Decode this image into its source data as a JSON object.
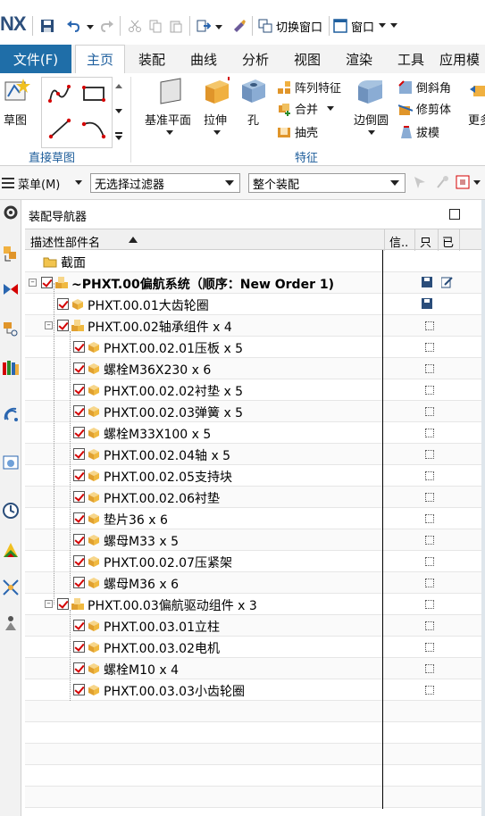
{
  "app": {
    "logo": "NX",
    "quick": {
      "switch_window": "切换窗口",
      "window": "窗口"
    }
  },
  "tabs": [
    "文件(F)",
    "主页",
    "装配",
    "曲线",
    "分析",
    "视图",
    "渲染",
    "工具",
    "应用模"
  ],
  "ribbon": {
    "sketch": "草图",
    "group_direct_sketch": "直接草图",
    "datum_plane": "基准平面",
    "extrude": "拉伸",
    "hole": "孔",
    "pattern_feature": "阵列特征",
    "unite": "合并",
    "shell": "抽壳",
    "edge_blend": "边倒圆",
    "chamfer": "倒斜角",
    "trim_body": "修剪体",
    "draft": "拔模",
    "more": "更多",
    "group_feature": "特征"
  },
  "filterbar": {
    "menu": "菜单(M)",
    "filter": "无选择过滤器",
    "scope": "整个装配"
  },
  "navigator": {
    "title": "装配导航器",
    "col_name": "描述性部件名",
    "col_info": "信..",
    "col_b": "只",
    "col_c": "已",
    "rows": [
      {
        "label": "截面",
        "level": 0,
        "kind": "folder"
      },
      {
        "label": "~PHXT.00偏航系统（顺序：New Order 1)",
        "level": 0,
        "kind": "root"
      },
      {
        "label": "PHXT.00.01大齿轮圈",
        "level": 1,
        "kind": "part"
      },
      {
        "label": "PHXT.00.02轴承组件 x 4",
        "level": 1,
        "kind": "asm"
      },
      {
        "label": "PHXT.00.02.01压板 x 5",
        "level": 2,
        "kind": "part"
      },
      {
        "label": "螺栓M36X230 x 6",
        "level": 2,
        "kind": "part"
      },
      {
        "label": "PHXT.00.02.02衬垫 x 5",
        "level": 2,
        "kind": "part"
      },
      {
        "label": "PHXT.00.02.03弹簧 x 5",
        "level": 2,
        "kind": "part"
      },
      {
        "label": "螺栓M33X100 x 5",
        "level": 2,
        "kind": "part"
      },
      {
        "label": "PHXT.00.02.04轴 x 5",
        "level": 2,
        "kind": "part"
      },
      {
        "label": "PHXT.00.02.05支持块",
        "level": 2,
        "kind": "part"
      },
      {
        "label": "PHXT.00.02.06衬垫",
        "level": 2,
        "kind": "part"
      },
      {
        "label": "垫片36 x 6",
        "level": 2,
        "kind": "part"
      },
      {
        "label": "螺母M33 x 5",
        "level": 2,
        "kind": "part"
      },
      {
        "label": "PHXT.00.02.07压紧架",
        "level": 2,
        "kind": "part"
      },
      {
        "label": "螺母M36 x 6",
        "level": 2,
        "kind": "part"
      },
      {
        "label": "PHXT.00.03偏航驱动组件 x 3",
        "level": 1,
        "kind": "asm"
      },
      {
        "label": "PHXT.00.03.01立柱",
        "level": 2,
        "kind": "part"
      },
      {
        "label": "PHXT.00.03.02电机",
        "level": 2,
        "kind": "part"
      },
      {
        "label": "螺栓M10 x 4",
        "level": 2,
        "kind": "part"
      },
      {
        "label": "PHXT.00.03.03小齿轮圈",
        "level": 2,
        "kind": "part"
      }
    ]
  }
}
